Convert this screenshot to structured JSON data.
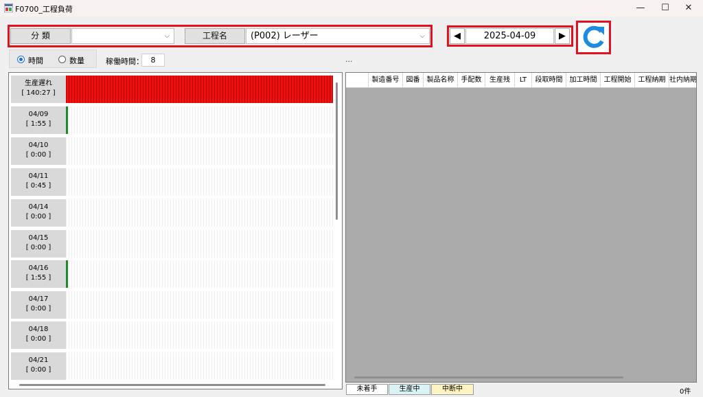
{
  "window": {
    "title": "F0700_工程負荷",
    "minimize": "—",
    "maximize": "☐",
    "close": "✕"
  },
  "toolbar": {
    "category_label": "分 類",
    "category_value": "",
    "process_label": "工程名",
    "process_value": "(P002) レーザー",
    "prev": "◀",
    "next": "▶",
    "date": "2025-04-09"
  },
  "options": {
    "radio_time": "時間",
    "radio_qty": "数量",
    "selected": "時間",
    "work_hours_label": "稼働時間：",
    "work_hours_value": "8",
    "ellipsis": "..."
  },
  "rows": [
    {
      "label": "生産遅れ",
      "value": "[ 140:27 ]"
    },
    {
      "label": "04/09",
      "value": "[ 1:55 ]"
    },
    {
      "label": "04/10",
      "value": "[ 0:00 ]"
    },
    {
      "label": "04/11",
      "value": "[ 0:45 ]"
    },
    {
      "label": "04/14",
      "value": "[ 0:00 ]"
    },
    {
      "label": "04/15",
      "value": "[ 0:00 ]"
    },
    {
      "label": "04/16",
      "value": "[ 1:55 ]"
    },
    {
      "label": "04/17",
      "value": "[ 0:00 ]"
    },
    {
      "label": "04/18",
      "value": "[ 0:00 ]"
    },
    {
      "label": "04/21",
      "value": "[ 0:00 ]"
    }
  ],
  "grid": {
    "columns": [
      "製造番号",
      "図番",
      "製品名称",
      "手配数",
      "生産残",
      "LT",
      "段取時間",
      "加工時間",
      "工程開始",
      "工程納期",
      "社内納期"
    ]
  },
  "legend": {
    "not_started": "未着手",
    "in_production": "生産中",
    "suspended": "中断中",
    "count": "0件"
  },
  "colors": {
    "highlight": "#e0121f",
    "delay": "#ee1111",
    "load": "#1f8a2a",
    "in_production": "#d9f3f7",
    "suspended": "#fff4c2"
  }
}
